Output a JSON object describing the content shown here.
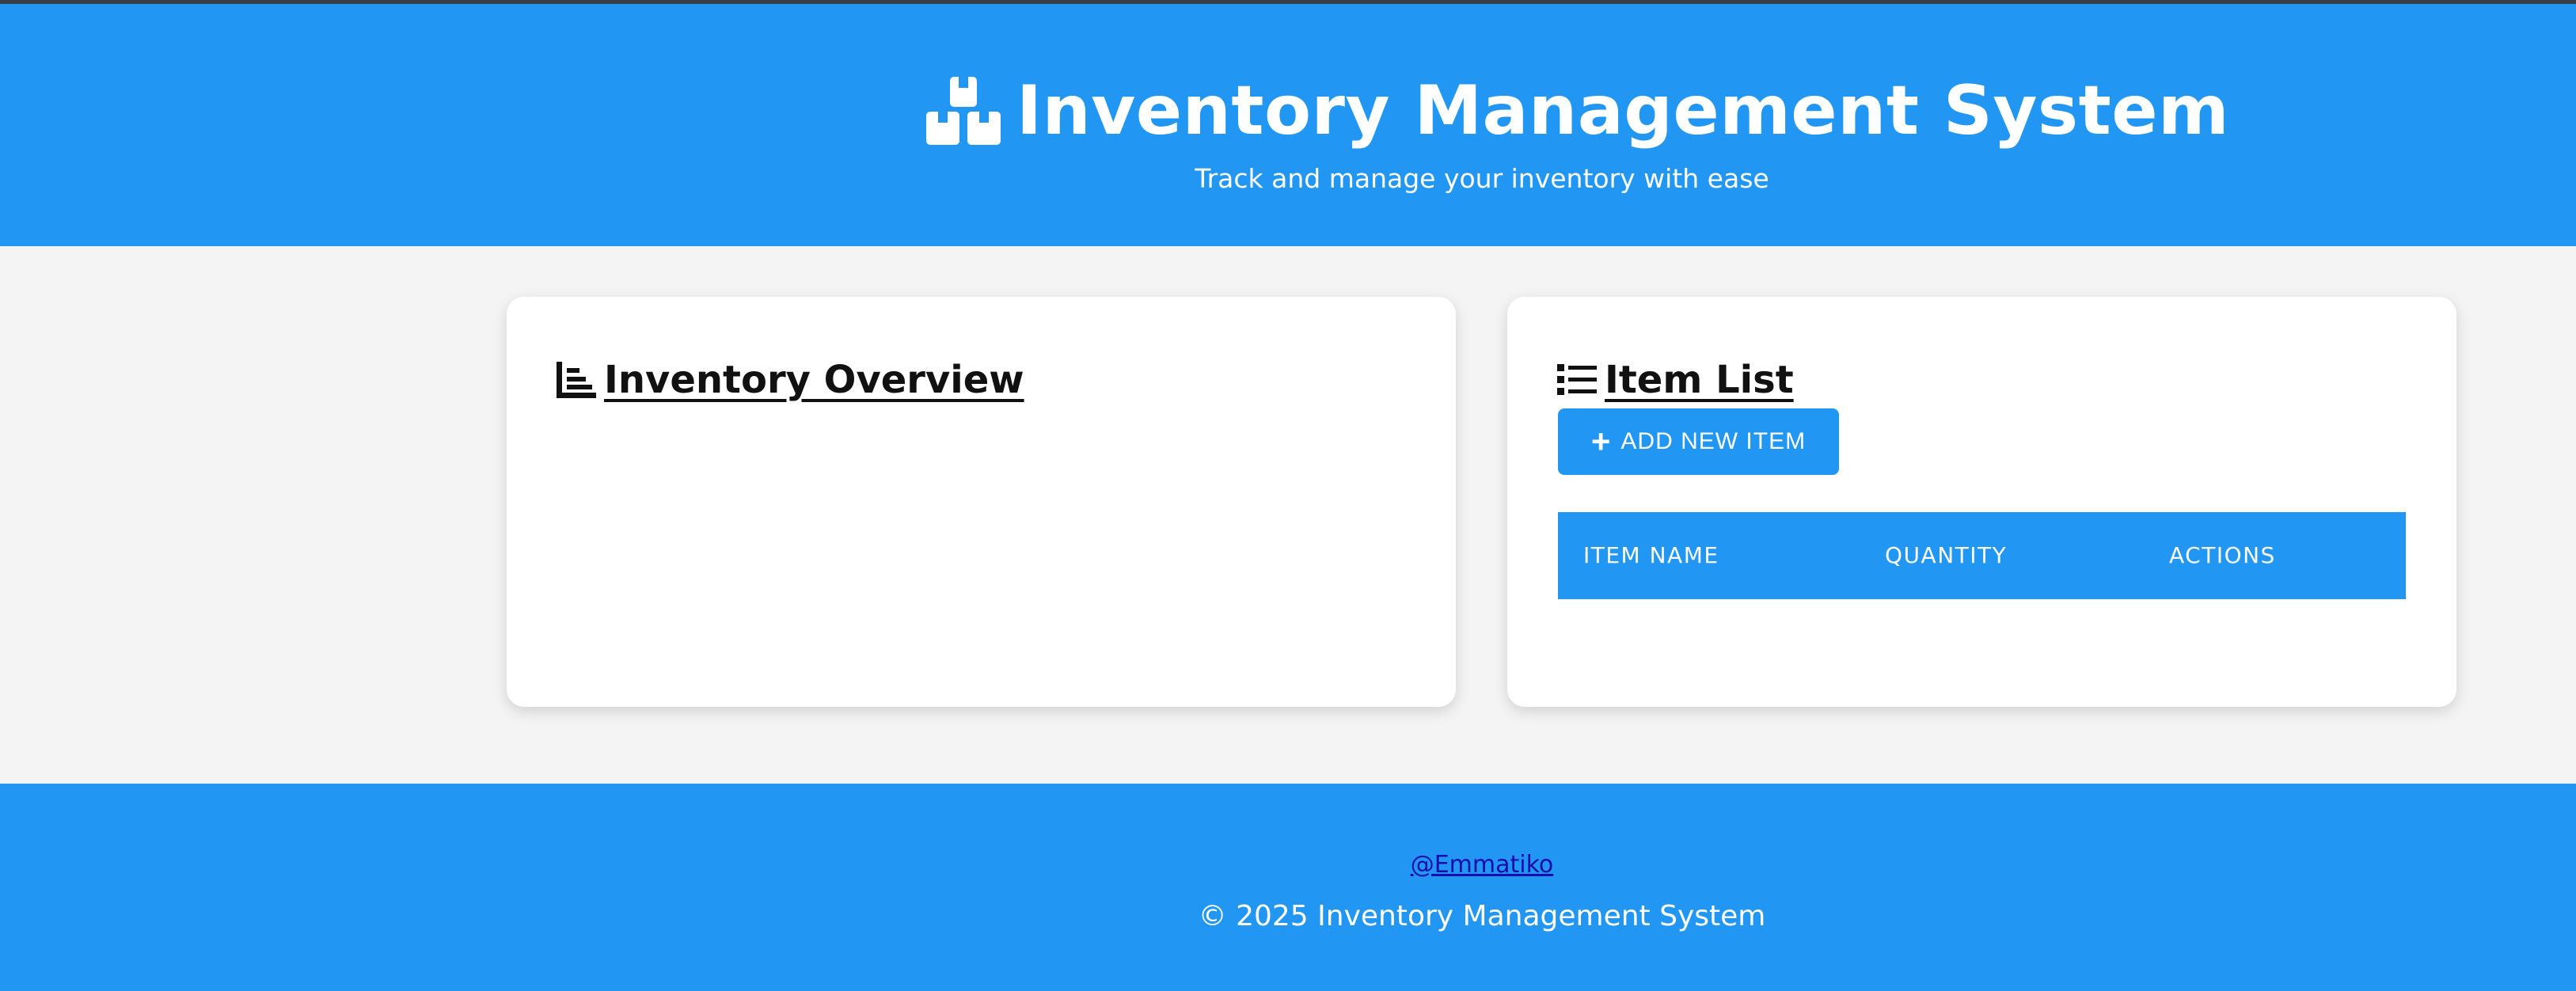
{
  "header": {
    "title": "Inventory Management System",
    "subtitle": "Track and manage your inventory with ease",
    "icon": "boxes-icon"
  },
  "overview": {
    "heading": "Inventory Overview",
    "icon": "chart-bar-icon"
  },
  "item_list": {
    "heading": "Item List",
    "icon": "list-icon",
    "add_button_label": "ADD NEW ITEM",
    "add_button_icon": "plus-icon",
    "columns": [
      "ITEM NAME",
      "QUANTITY",
      "ACTIONS"
    ],
    "rows": []
  },
  "footer": {
    "link": "@Emmatiko",
    "copyright": "© 2025 Inventory Management System"
  },
  "colors": {
    "primary": "#2196f3",
    "background": "#f4f4f4",
    "card": "#ffffff",
    "link": "#1a0dab"
  }
}
